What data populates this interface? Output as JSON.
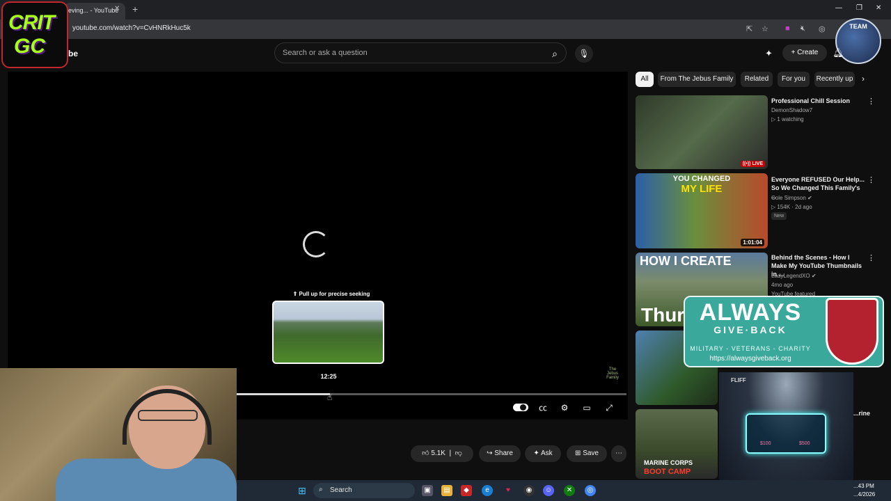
{
  "browser": {
    "tab_title": "eving... - YouTube",
    "url": "youtube.com/watch?v=CvHNRkHuc5k"
  },
  "overlays": {
    "logo_line1": "CRIT",
    "logo_line2": "GC",
    "badge_text": "TEAM",
    "yt_logo_partial": "be"
  },
  "header": {
    "search_placeholder": "Search or ask a question",
    "create_label": "Create"
  },
  "player": {
    "seek_hint": "⇑ Pull up for precise seeking",
    "preview_time": "12:25",
    "progress_fraction": 0.24,
    "watermark": "The Jebus Family"
  },
  "actions": {
    "likes": "5.1K",
    "share": "Share",
    "ask": "Ask",
    "save": "Save"
  },
  "chips": [
    "All",
    "From The Jebus Family",
    "Related",
    "For you",
    "Recently up"
  ],
  "recommendations": [
    {
      "title": "Professional Chill Session",
      "channel": "DemonShadow7",
      "meta": "▷ 1 watching",
      "badge": "((•)) LIVE"
    },
    {
      "title": "Everyone REFUSED Our Help... So We Changed This Family's ...",
      "channel": "Cole Simpson ✔",
      "meta": "▷ 154K · 2d ago",
      "duration": "1:01:04",
      "new_label": "New",
      "thumb_text1": "YOU CHANGED",
      "thumb_text2": "MY LIFE"
    },
    {
      "title": "Behind the Scenes - How I Make My YouTube Thumbnails in ...",
      "channel": "LadyLegendXO ✔",
      "meta": "4mo ago",
      "extra": "YouTube featured",
      "thumb_text1": "HOW I CREATE",
      "thumb_text2": "Thur"
    },
    {
      "title": "",
      "channel": "",
      "meta": ""
    },
    {
      "title": "...rine",
      "channel": "",
      "meta": "",
      "thumb_text1": "MARINE CORPS",
      "thumb_text2": "BOOT CAMP"
    }
  ],
  "agb": {
    "title": "ALWAYS",
    "subtitle": "GIVE·BACK",
    "tagline": "MILITARY - VETERANS - CHARITY",
    "url": "https://alwaysgiveback.org"
  },
  "ad": {
    "label": "FLIFF",
    "value1": "$100",
    "value2": "$500"
  },
  "taskbar": {
    "search": "Search",
    "time": "...43 PM",
    "date": "...4/2026"
  },
  "colors": {
    "background": "#0f0f0f",
    "accent_live": "#cc0000",
    "agb_teal": "#3aa89a",
    "logo_green": "#a6ff1a"
  }
}
